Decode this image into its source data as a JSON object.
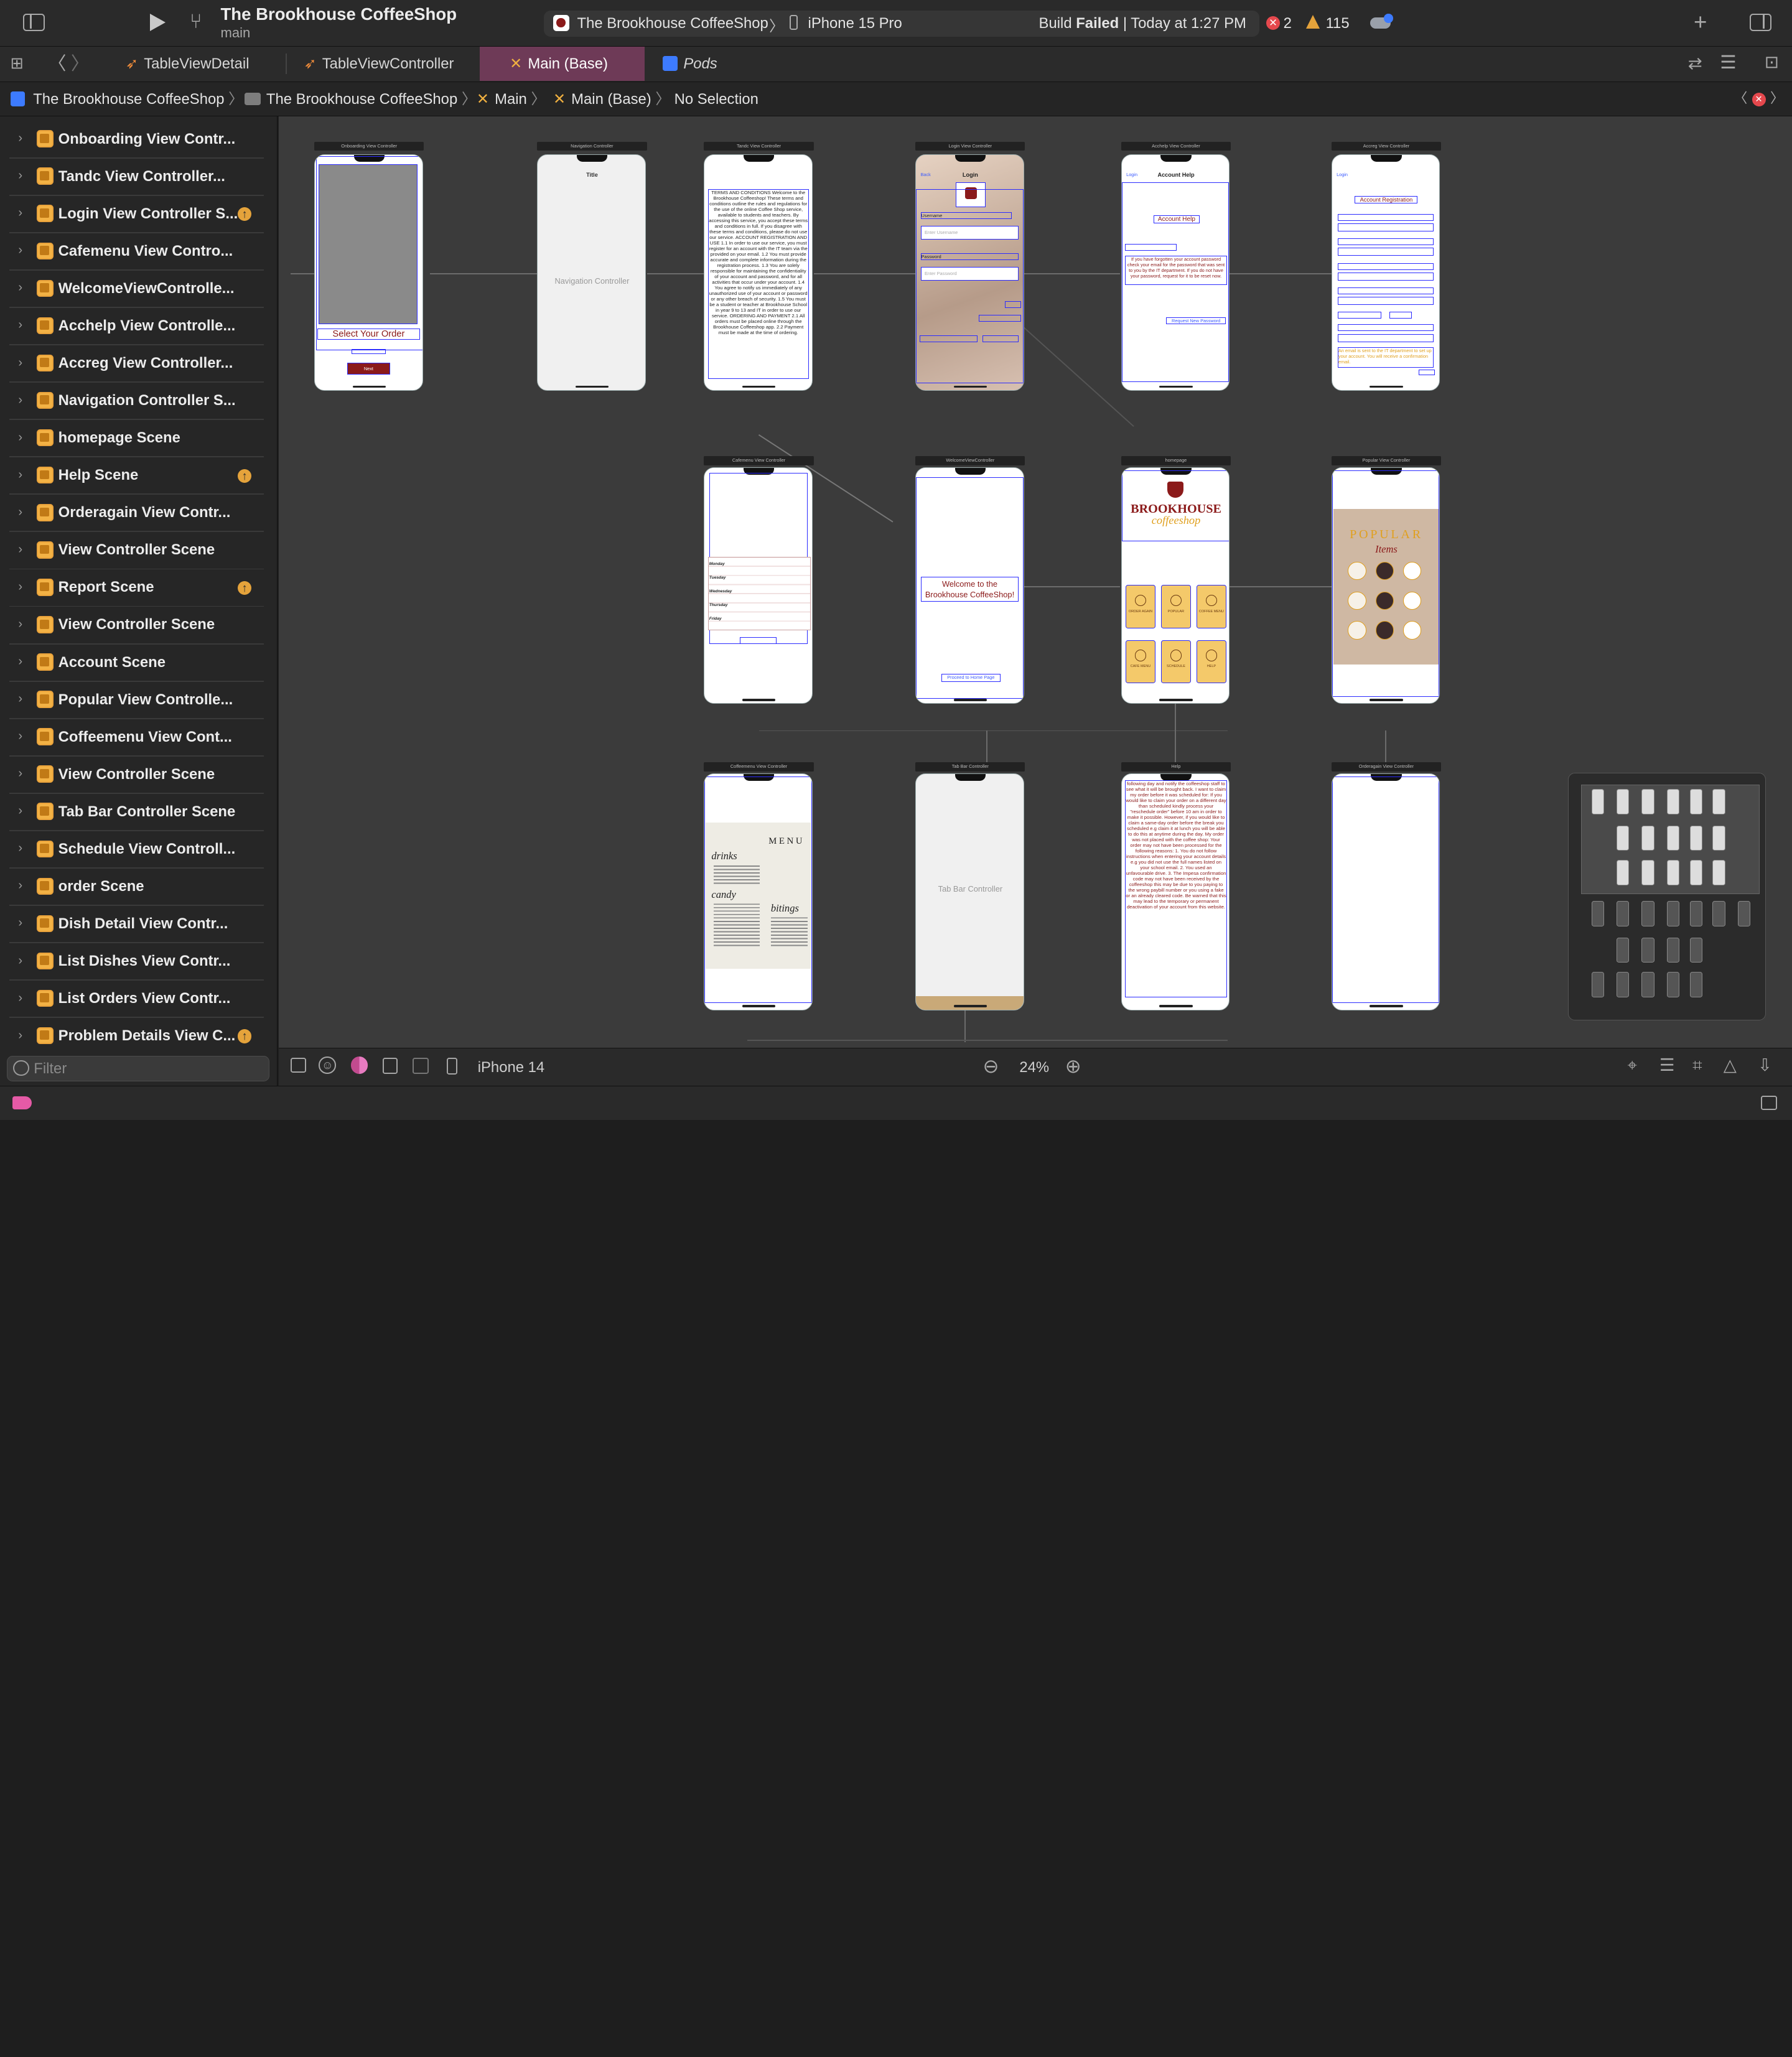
{
  "toolbar": {
    "project": "The Brookhouse CoffeeShop",
    "branch": "main",
    "scheme": "The Brookhouse CoffeeShop",
    "device": "iPhone 15 Pro",
    "build_status_prefix": "Build ",
    "build_status_bold": "Failed",
    "build_status_suffix": " | Today at 1:27 PM",
    "errors": "2",
    "warnings": "115"
  },
  "tabs": [
    "TableViewDetail",
    "TableViewController",
    "Main (Base)",
    "Pods"
  ],
  "breadcrumb": [
    "The Brookhouse CoffeeShop",
    "The Brookhouse CoffeeShop",
    "Main",
    "Main (Base)",
    "No Selection"
  ],
  "navigator": {
    "items": [
      {
        "label": "Onboarding View Contr...",
        "warn": false
      },
      {
        "label": "Tandc View Controller...",
        "warn": false
      },
      {
        "label": "Login View Controller S...",
        "warn": true
      },
      {
        "label": "Cafemenu View Contro...",
        "warn": false
      },
      {
        "label": "WelcomeViewControlle...",
        "warn": false
      },
      {
        "label": "Acchelp View Controlle...",
        "warn": false
      },
      {
        "label": "Accreg View Controller...",
        "warn": false
      },
      {
        "label": "Navigation Controller S...",
        "warn": false
      },
      {
        "label": "homepage Scene",
        "warn": false
      },
      {
        "label": "Help Scene",
        "warn": true
      },
      {
        "label": "Orderagain View Contr...",
        "warn": false
      },
      {
        "label": "View Controller Scene",
        "warn": false
      },
      {
        "label": "Report Scene",
        "warn": true
      },
      {
        "label": "View Controller Scene",
        "warn": false
      },
      {
        "label": "Account  Scene",
        "warn": false
      },
      {
        "label": "Popular View Controlle...",
        "warn": false
      },
      {
        "label": "Coffeemenu View Cont...",
        "warn": false
      },
      {
        "label": "View Controller Scene",
        "warn": false
      },
      {
        "label": "Tab Bar Controller Scene",
        "warn": false
      },
      {
        "label": "Schedule View Controll...",
        "warn": false
      },
      {
        "label": "order Scene",
        "warn": false
      },
      {
        "label": "Dish Detail View Contr...",
        "warn": false
      },
      {
        "label": "List Dishes View Contr...",
        "warn": false
      },
      {
        "label": "List Orders View Contr...",
        "warn": false
      },
      {
        "label": "Problem Details View C...",
        "warn": true
      }
    ],
    "filter_placeholder": "Filter"
  },
  "canvas": {
    "onboarding": {
      "header": "Onboarding View Controller",
      "select": "Select Your Order",
      "next": "Next"
    },
    "nav": {
      "header": "Navigation Controller",
      "title": "Title",
      "body": "Navigation Controller"
    },
    "tandc": {
      "header": "Tandc View Controller",
      "text": "TERMS AND CONDITIONS Welcome to the Brookhouse Coffeeshop! These terms and conditions outline the rules and regulations for the use of the online Coffee Shop service, available to students and teachers. By accessing this service, you accept these terms and conditions in full. If you disagree with these terms and conditions, please do not use our service. ACCOUNT REGISTRATION AND USE 1.1 In order to use our service, you must register for an account with the IT team via the provided on your email. 1.2 You must provide accurate and complete information during the registration process. 1.3 You are solely responsible for maintaining the confidentiality of your account and password, and for all activities that occur under your account. 1.4 You agree to notify us immediately of any unauthorized use of your account or password or any other breach of security. 1.5 You must be a student or teacher at Brookhouse School in year 9 to 13 and IT in order to use our service. ORDERING AND PAYMENT 2.1 All orders must be placed online through the Brookhouse Coffeeshop app. 2.2 Payment must be made at the time of ordering."
    },
    "login": {
      "header": "Login View Controller",
      "back": "Back",
      "title": "Login",
      "username": "Username",
      "username_ph": "Enter Username",
      "password": "Password",
      "password_ph": "Enter Password"
    },
    "acchelp": {
      "header": "Acchelp View Controller",
      "back": "Login",
      "title": "Account Help",
      "heading": "Account Help",
      "text": "If you have forgotten your account password check your email for the password that was sent to you by the IT department. If you do not have your password, request for it to be reset now.",
      "btn": "Request New Password"
    },
    "accreg": {
      "header": "Accreg View Controller",
      "back": "Login",
      "title": "Account Registration",
      "note": "An email is sent to the IT department to set up your account. You will receive a confirmation email."
    },
    "cafemenu": {
      "header": "Cafemenu View Controller",
      "days": [
        "Monday",
        "Tuesday",
        "Wednesday",
        "Thursday",
        "Friday"
      ]
    },
    "welcome": {
      "header": "WelcomeViewController",
      "text": "Welcome to the Brookhouse CoffeeShop!",
      "btn": "Proceed to Home Page"
    },
    "homepage": {
      "header": "homepage",
      "brand1": "BROOKHOUSE",
      "brand2": "coffeeshop",
      "tiles": [
        "ORDER AGAIN",
        "POPULAR",
        "COFFEE MENU",
        "CAFE MENU",
        "SCHEDULE",
        "HELP"
      ]
    },
    "popular": {
      "header": "Popular View Controller",
      "title1": "POPULAR",
      "title2": "Items"
    },
    "coffeemenu": {
      "header": "Coffeemenu View Controller",
      "menu": "MENU",
      "drinks": "drinks",
      "candy": "candy",
      "bitings": "bitings"
    },
    "tabbar": {
      "header": "Tab Bar Controller",
      "body": "Tab Bar Controller"
    },
    "help": {
      "header": "Help",
      "text": "following day and notify the coffeeshop staff to see what it will be brought back. I want to claim my order before it was scheduled for: If you would like to claim your order on a different day than scheduled kindly process your \"reschedule order\" before 10 am in order to make it possible. However, if you would like to claim a same-day order before the break you scheduled e.g claim it at lunch you will be able to do this at anytime during the day. My order was not placed with the coffee shop: Your order may not have been processed for the following reasons: 1. You do not follow instructions when entering your account details e.g you did not use the full names listed on your school email. 2. You used an unfavourable drive. 3. The Impesa confirmation code may not have been received by the coffeeshop this may be due to you paying to the wrong paybill number or you using a fake or an already cleared code. Be warned that this may lead to the temporary or permanent deactivation of your account from this website."
    },
    "orderagain": {
      "header": "Orderagain View Controller"
    }
  },
  "bottombar": {
    "device": "iPhone 14",
    "zoom": "24%"
  },
  "colors": {
    "accent": "#2b2bff",
    "brand": "#8b1a1a",
    "warning": "#e5a33b",
    "error": "#e5484d"
  }
}
